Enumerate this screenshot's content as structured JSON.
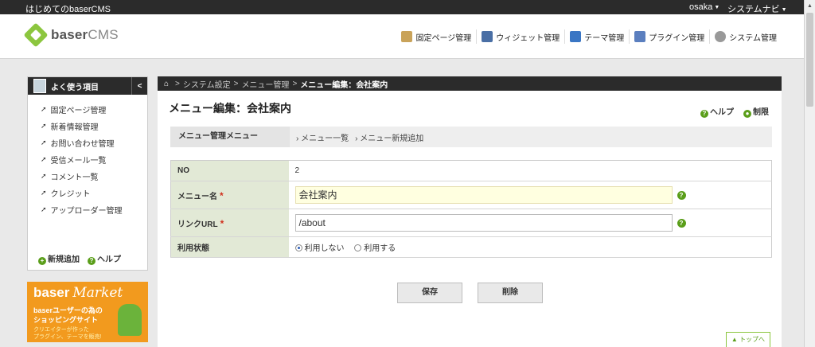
{
  "topbar": {
    "site_name": "はじめてのbaserCMS",
    "user": "osaka",
    "system_nav": "システムナビ"
  },
  "header": {
    "logo_primary": "baser",
    "logo_secondary": "CMS",
    "nav": [
      {
        "label": "固定ページ管理",
        "icon": "page-icon",
        "color": "#c9a35a"
      },
      {
        "label": "ウィジェット管理",
        "icon": "widget-icon",
        "color": "#4a6fa5"
      },
      {
        "label": "テーマ管理",
        "icon": "theme-icon",
        "color": "#3a76c4"
      },
      {
        "label": "プラグイン管理",
        "icon": "plugin-icon",
        "color": "#5b7fbf"
      },
      {
        "label": "システム管理",
        "icon": "gear-icon",
        "color": "#999999"
      }
    ]
  },
  "sidebar": {
    "title": "よく使う項目",
    "collapse": "<",
    "items": [
      {
        "label": "固定ページ管理"
      },
      {
        "label": "新着情報管理"
      },
      {
        "label": "お問い合わせ管理"
      },
      {
        "label": "受信メール一覧"
      },
      {
        "label": "コメント一覧"
      },
      {
        "label": "クレジット"
      },
      {
        "label": "アップローダー管理"
      }
    ],
    "footer_add": "新規追加",
    "footer_help": "ヘルプ"
  },
  "banner": {
    "title": "baser",
    "title_script": "Market",
    "line1": "baserユーザーの為の",
    "line2": "ショッピングサイト",
    "line3": "クリエイターが作った",
    "line4": "プラグイン、テーマを販売!"
  },
  "breadcrumb": {
    "items": [
      "システム設定",
      "メニュー管理"
    ],
    "current": "メニュー編集：会社案内"
  },
  "page": {
    "title": "メニュー編集：会社案内",
    "help": "ヘルプ",
    "restrict": "制限"
  },
  "subnav": {
    "label": "メニュー管理メニュー",
    "links": [
      "メニュー一覧",
      "メニュー新規追加"
    ]
  },
  "form": {
    "no_label": "NO",
    "no_value": "2",
    "name_label": "メニュー名",
    "name_value": "会社案内",
    "url_label": "リンクURL",
    "url_value": "/about",
    "status_label": "利用状態",
    "status_off": "利用しない",
    "status_on": "利用する",
    "required_mark": "*",
    "help_mark": "?"
  },
  "buttons": {
    "save": "保存",
    "delete": "削除",
    "to_top": "▲ トップへ"
  },
  "colors": {
    "accent": "#5a9e1a",
    "dark": "#2b2b2b",
    "label_bg": "#e2e9d6"
  }
}
